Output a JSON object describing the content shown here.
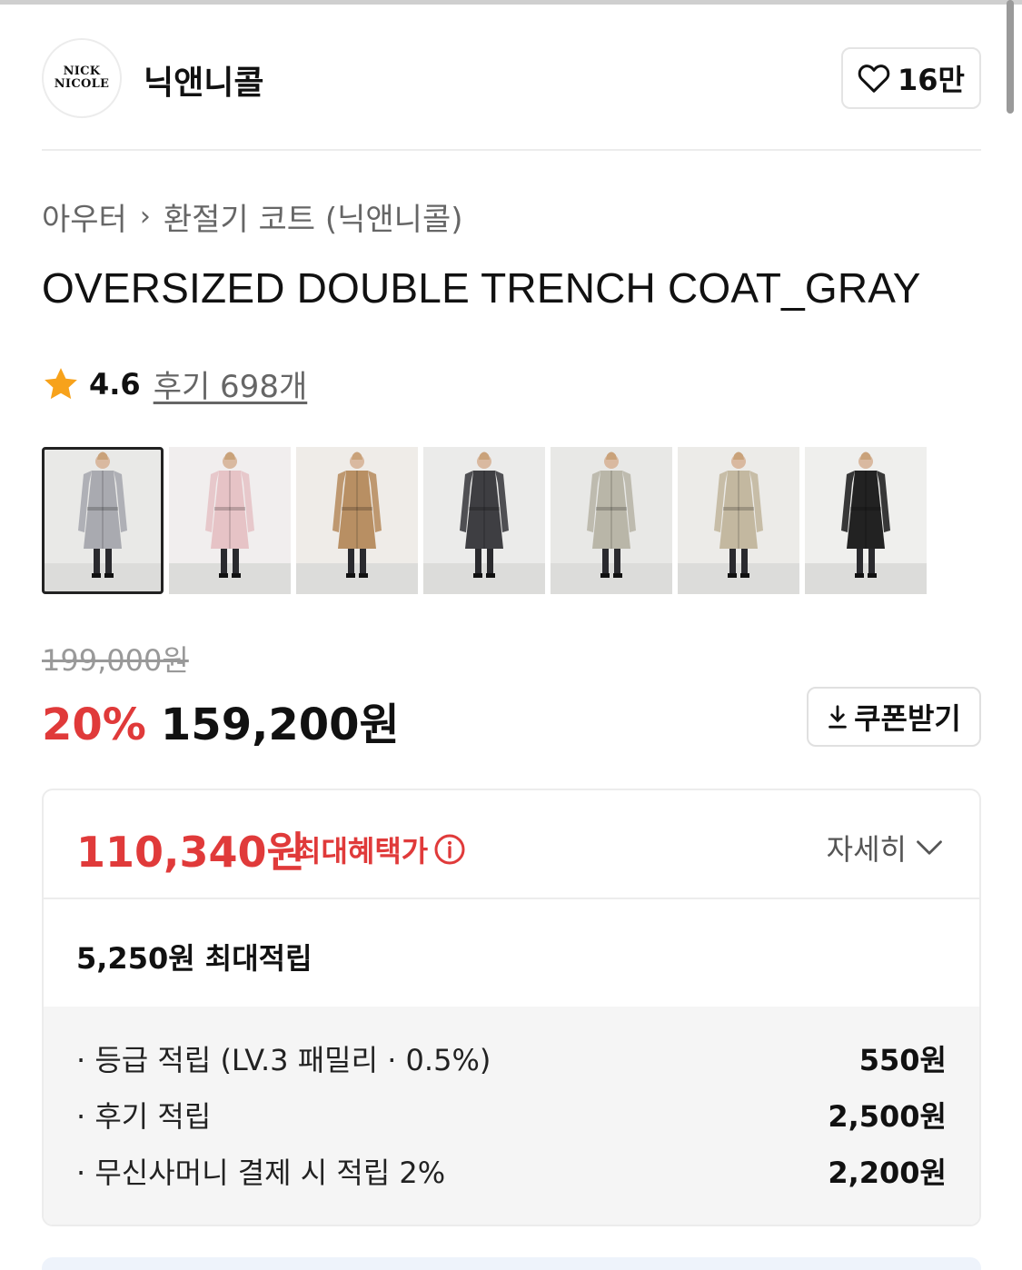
{
  "brand": {
    "logo_line1": "NICK",
    "logo_line2": "NICOLE",
    "name": "닉앤니콜",
    "likes": "16만"
  },
  "breadcrumb": {
    "category": "아우터",
    "subcategory": "환절기 코트 (닉앤니콜)"
  },
  "product": {
    "title": "OVERSIZED DOUBLE TRENCH COAT_GRAY",
    "rating": "4.6",
    "review_label": "후기 698개",
    "thumbnails": [
      {
        "name": "gray-coat",
        "color": "#a9aab0"
      },
      {
        "name": "pink-coat",
        "color": "#e6c3c6"
      },
      {
        "name": "beige-coat",
        "color": "#b88f63"
      },
      {
        "name": "charcoal-coat",
        "color": "#3e3e42"
      },
      {
        "name": "light-gray-coat",
        "color": "#b9b6a8"
      },
      {
        "name": "stone-coat",
        "color": "#c3b8a0"
      },
      {
        "name": "black-coat",
        "color": "#222222"
      }
    ]
  },
  "price": {
    "original": "199,000원",
    "discount": "20%",
    "sale": "159,200원",
    "coupon_label": "쿠폰받기"
  },
  "benefit": {
    "max_price": "110,340원",
    "max_label": "최대혜택가",
    "detail_label": "자세히",
    "points_total": "5,250원 최대적립",
    "points": [
      {
        "label": "등급 적립 (LV.3 패밀리 · 0.5%)",
        "amount": "550원"
      },
      {
        "label": "후기 적립",
        "amount": "2,500원"
      },
      {
        "label": "무신사머니 결제 시 적립 2%",
        "amount": "2,200원"
      }
    ]
  },
  "colors": {
    "accent_red": "#e03a3a",
    "star": "#f7a21b"
  }
}
